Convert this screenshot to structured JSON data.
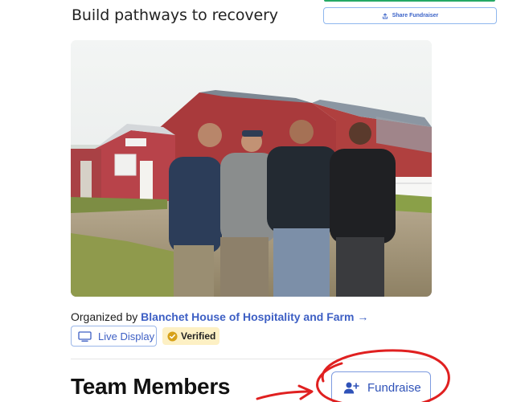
{
  "page": {
    "title": "Build pathways to recovery"
  },
  "share": {
    "label": "Share Fundraiser",
    "icon": "share-upload-icon"
  },
  "photo": {
    "alt": "Four men standing arm in arm in front of a red barn"
  },
  "organizer": {
    "prefix": "Organized by",
    "name": "Blanchet House of Hospitality and Farm",
    "arrow": "→"
  },
  "live_display": {
    "label": "Live Display",
    "icon": "monitor-icon"
  },
  "verified": {
    "label": "Verified",
    "icon": "check-circle-icon",
    "color": "#d7a21a"
  },
  "team": {
    "title": "Team Members"
  },
  "fundraise": {
    "label": "Fundraise",
    "icon": "add-person-icon"
  },
  "annotation": {
    "color": "#e02020"
  },
  "colors": {
    "link_blue": "#3d5fc4",
    "badge_bg": "#fdf0c4",
    "green_bar": "#25a865"
  }
}
